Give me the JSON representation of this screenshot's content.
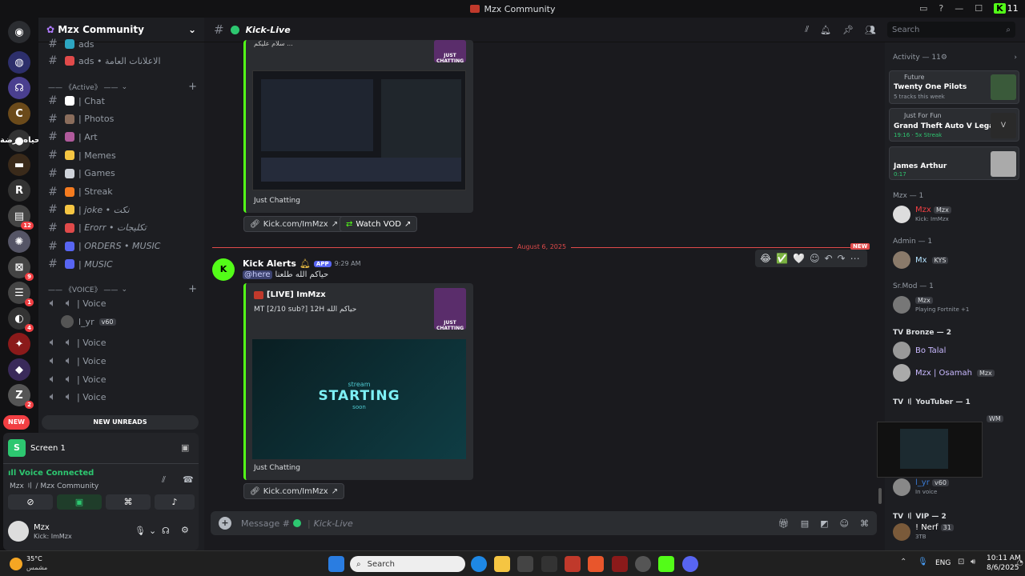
{
  "window": {
    "title": "Mzx Community"
  },
  "server": {
    "name": "Mzx Community"
  },
  "guild_badges": [
    "12",
    "9",
    "1",
    "4",
    "2"
  ],
  "channels_top": [
    {
      "name": "ads",
      "emoji_color": "#2da6c2"
    },
    {
      "name": "ads • الاعلانات العامة",
      "emoji_color": "#e04a4a"
    }
  ],
  "cat_active": "—— 《Active》 ——",
  "channels_active": [
    {
      "name": "| Chat",
      "emoji_color": "#ffffff"
    },
    {
      "name": "| Photos",
      "emoji_color": "#8a6d5c"
    },
    {
      "name": "| Art",
      "emoji_color": "#b05a9c"
    },
    {
      "name": "| Memes",
      "emoji_color": "#f5c542"
    },
    {
      "name": "| Games",
      "emoji_color": "#cfd3da"
    },
    {
      "name": "| Streak",
      "emoji_color": "#f57b1f"
    },
    {
      "name": "| joke • نكت",
      "emoji_color": "#f5c542"
    },
    {
      "name": "| Erorr • تكليجات",
      "emoji_color": "#e04a4a"
    },
    {
      "name": "| ORDERS • MUSIC",
      "emoji_color": "#5865f2"
    },
    {
      "name": "| MUSIC",
      "emoji_color": "#5865f2"
    }
  ],
  "cat_voice": "—— 《VOICE》 ——",
  "voice_channels": [
    "| Voice",
    "| Voice",
    "| Voice",
    "| Voice",
    "| Voice"
  ],
  "voice_user": {
    "name": "l_yr",
    "tag": "v60"
  },
  "new_tag": "NEW",
  "new_unreads": "NEW UNREADS",
  "side_overlay": "حياه برضة",
  "screen_share": "Screen 1",
  "voice": {
    "status": "Voice Connected",
    "location": "Mzx 〢 / Mzx Community"
  },
  "user": {
    "name": "Mzx",
    "status": "Kick: ImMzx"
  },
  "channel_header": {
    "name": "Kick-Live",
    "search_placeholder": "Search"
  },
  "embed_top": {
    "author_text": "سلام عليكم ...",
    "label": "Just Chatting",
    "thumb": "JUST CHATTING",
    "link": "Kick.com/ImMzx",
    "vod": "Watch VOD"
  },
  "date_divider": "August 6, 2025",
  "new_marker": "NEW",
  "message": {
    "author": "Kick Alerts",
    "app": "APP",
    "time": "9:29 AM",
    "mention": "@here",
    "text": "حياكم الله طلعنا",
    "embed": {
      "title": "[LIVE] ImMzx",
      "desc": "MT [2/10 sub?] 12H حياكم الله",
      "img_small": "stream",
      "img_big": "STARTING",
      "img_sub": "soon",
      "footer": "Just Chatting",
      "thumb": "JUST CHATTING"
    },
    "link": "Kick.com/ImMzx"
  },
  "composer": {
    "placeholder": "Message #",
    "channel": "Kick-Live"
  },
  "activity": {
    "title": "Activity — 11",
    "cards": [
      {
        "small": "Future",
        "title": "Twenty One Pilots",
        "sub": "5 tracks this week"
      },
      {
        "small": "Just For Fun",
        "title": "Grand Theft Auto V Legacy",
        "sub": "19:16 · 5x Streak"
      },
      {
        "small": "",
        "title": "James Arthur",
        "sub": "0:17"
      }
    ]
  },
  "members": {
    "g1": "Mzx — 1",
    "m1": {
      "name": "Mzx",
      "tag": "Mzx",
      "status": "Kick: ImMzx"
    },
    "g2": "Admin — 1",
    "m2": {
      "name": "Mx",
      "tag": "KYS"
    },
    "g3": "Sr.Mod — 1",
    "m3": {
      "name": "",
      "tag": "Mzx",
      "status": "Playing Fortnite +1"
    },
    "g4": "TV Bronze — 2",
    "m4": {
      "name": "Bo Talal"
    },
    "m5": {
      "name": "Mzx | Osamah",
      "tag": "Mzx"
    },
    "g5": "TV 〢 YouTuber — 1",
    "m6": {
      "tag": "WM"
    },
    "m7": {
      "name": "l_yr",
      "tag": "v60",
      "status": "In voice"
    },
    "g6": "TV 〢 VIP — 2",
    "m8": {
      "name": "! Nerf",
      "tag": "31",
      "status": "3TB"
    }
  },
  "weather": {
    "temp": "35°C",
    "desc": "مشمس"
  },
  "taskbar": {
    "search": "Search",
    "lang": "ENG",
    "time": "10:11 AM",
    "date": "8/6/2025",
    "top_counter": "11"
  }
}
